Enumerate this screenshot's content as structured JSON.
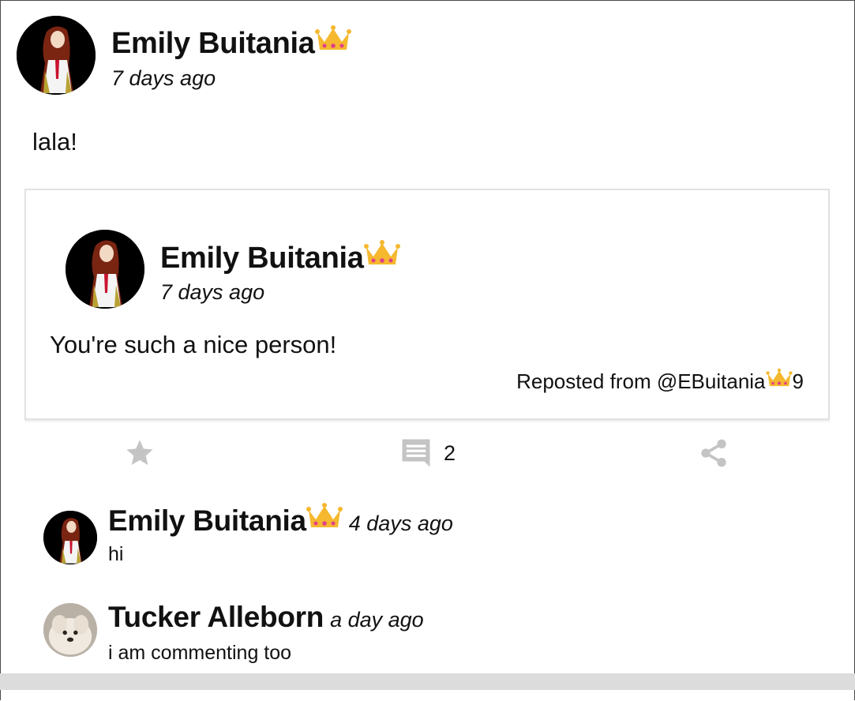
{
  "post": {
    "author": "Emily Buitania",
    "author_badge": "crown-icon",
    "time": "7 days ago",
    "text": "lala!"
  },
  "repost": {
    "author": "Emily Buitania",
    "author_badge": "crown-icon",
    "time": "7 days ago",
    "text": "You're such a nice person!",
    "credit_prefix": "Reposted from @EBuitania",
    "credit_suffix": "9"
  },
  "actions": {
    "star_icon": "star-icon",
    "comment_icon": "comment-icon",
    "comment_count": "2",
    "share_icon": "share-icon"
  },
  "comments": [
    {
      "author": "Emily Buitania",
      "author_badge": "crown-icon",
      "time": "4 days ago",
      "text": "hi"
    },
    {
      "author": "Tucker Alleborn",
      "time": "a day ago",
      "text": "i am commenting too"
    }
  ],
  "colors": {
    "icon_gray": "#c4c4c4",
    "crown_gold": "#f5b82e",
    "crown_gem": "#e0408a",
    "card_border": "#e2e2e2",
    "footer_bar": "#dcdcdc"
  }
}
